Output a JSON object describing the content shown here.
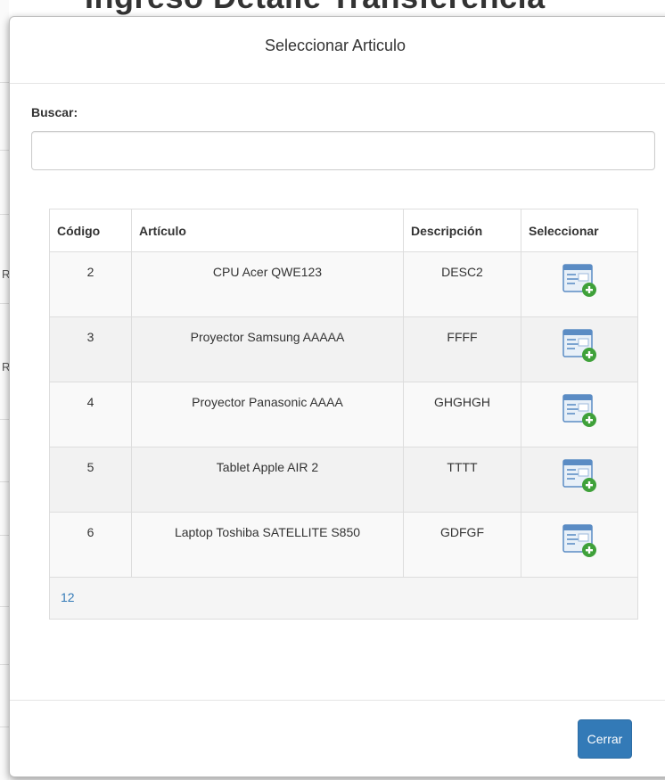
{
  "background": {
    "page_title": "Ingreso Detalle Transferencia",
    "side_glyphs": [
      "R",
      "R"
    ]
  },
  "modal": {
    "title": "Seleccionar Articulo",
    "search": {
      "label": "Buscar:",
      "value": "",
      "placeholder": ""
    },
    "table": {
      "headers": {
        "codigo": "Código",
        "articulo": "Artículo",
        "descripcion": "Descripción",
        "seleccionar": "Seleccionar"
      },
      "rows": [
        {
          "codigo": "2",
          "articulo": "CPU Acer QWE123",
          "descripcion": "DESC2",
          "icon": "add-item-icon"
        },
        {
          "codigo": "3",
          "articulo": "Proyector Samsung AAAAA",
          "descripcion": "FFFF",
          "icon": "add-item-icon"
        },
        {
          "codigo": "4",
          "articulo": "Proyector Panasonic AAAA",
          "descripcion": "GHGHGH",
          "icon": "add-item-icon"
        },
        {
          "codigo": "5",
          "articulo": "Tablet Apple AIR 2",
          "descripcion": "TTTT",
          "icon": "add-item-icon"
        },
        {
          "codigo": "6",
          "articulo": "Laptop Toshiba SATELLITE S850",
          "descripcion": "GDFGF",
          "icon": "add-item-icon"
        }
      ],
      "pager": {
        "pages": [
          "1",
          "2"
        ]
      }
    },
    "footer": {
      "close_label": "Cerrar"
    }
  },
  "colors": {
    "primary": "#337ab7",
    "link": "#337ab7",
    "border": "#dddddd",
    "stripe": "#f9f9f9"
  }
}
